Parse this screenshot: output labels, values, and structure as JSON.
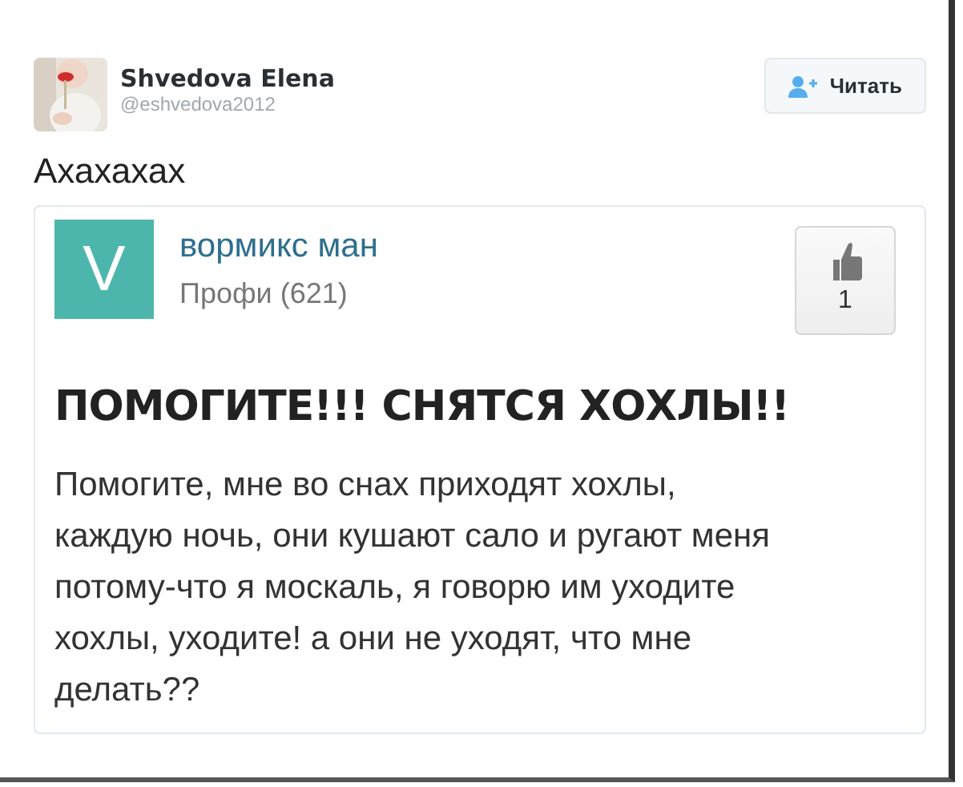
{
  "tweet": {
    "author": {
      "name": "Shvedova Elena",
      "handle": "@eshvedova2012"
    },
    "follow_button": {
      "label": "Читать"
    },
    "text": "Ахахахах",
    "embed": {
      "avatar_letter": "V",
      "user_name": "вормикс ман",
      "rank": "Профи (621)",
      "like_count": "1",
      "title": "ПОМОГИТЕ!!! СНЯТСЯ ХОХЛЫ!!",
      "body": "Помогите, мне во снах приходят хохлы, каждую ночь, они кушают сало и ругают меня потому-что я москаль, я говорю им уходите хохлы, уходите! а они не уходят, что мне делать??"
    }
  }
}
